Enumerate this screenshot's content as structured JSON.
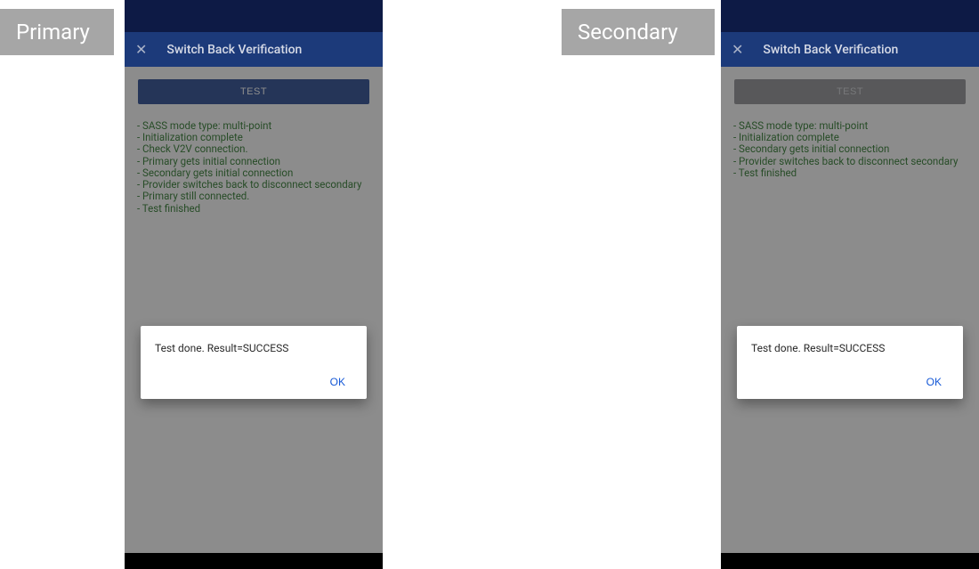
{
  "labels": {
    "primary": "Primary",
    "secondary": "Secondary"
  },
  "left": {
    "appbar": {
      "title": "Switch Back Verification",
      "close_icon": "✕"
    },
    "test_button_label": "TEST",
    "log": [
      "- SASS mode type: multi-point",
      "- Initialization complete",
      "- Check V2V connection.",
      "- Primary gets initial connection",
      "- Secondary gets initial connection",
      "- Provider switches back to disconnect secondary",
      "- Primary still connected.",
      "- Test finished"
    ],
    "dialog": {
      "message": "Test done. Result=SUCCESS",
      "ok_label": "OK"
    }
  },
  "right": {
    "appbar": {
      "title": "Switch Back Verification",
      "close_icon": "✕"
    },
    "test_button_label": "TEST",
    "log": [
      "- SASS mode type: multi-point",
      "- Initialization complete",
      "- Secondary gets initial connection",
      "- Provider switches back to disconnect secondary",
      "- Test finished"
    ],
    "dialog": {
      "message": "Test done. Result=SUCCESS",
      "ok_label": "OK"
    }
  }
}
